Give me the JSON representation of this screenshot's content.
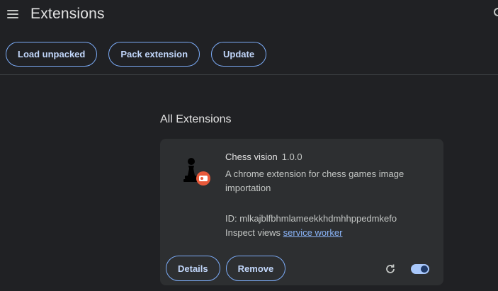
{
  "header": {
    "title": "Extensions",
    "menu_icon": "hamburger-menu-icon",
    "search_icon": "search-icon"
  },
  "toolbar": {
    "load_unpacked_label": "Load unpacked",
    "pack_extension_label": "Pack extension",
    "update_label": "Update"
  },
  "section": {
    "title": "All Extensions"
  },
  "extension": {
    "name": "Chess vision",
    "version": "1.0.0",
    "description": "A chrome extension for chess games image importation",
    "id_text": "ID: mlkajblfbhmlameekkhdmhhppedmkefo",
    "inspect_label": "Inspect views",
    "inspect_link": "service worker",
    "details_label": "Details",
    "remove_label": "Remove",
    "enabled": true,
    "icon": "chess-pawn-icon",
    "badge_icon": "record-badge-icon"
  },
  "colors": {
    "background": "#202124",
    "card": "#2d2f31",
    "accent": "#a8c7fa",
    "button_border": "#7cacf8",
    "link": "#8ab4f8",
    "badge": "#e8593a"
  }
}
